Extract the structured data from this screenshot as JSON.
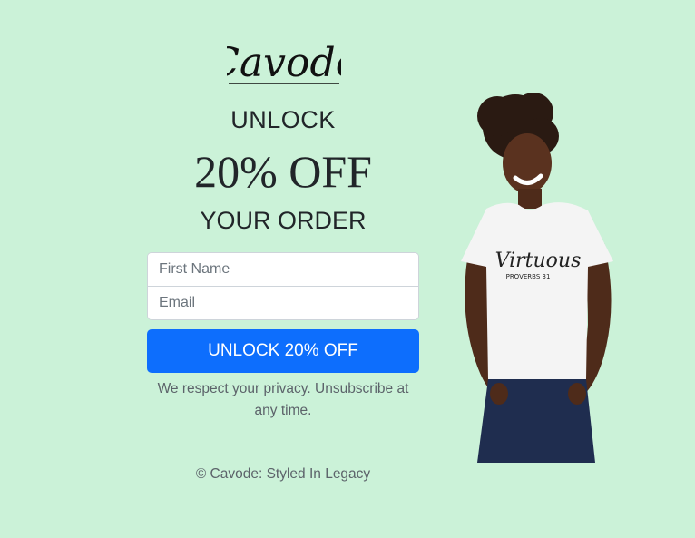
{
  "brand": {
    "logo_text": "Cavode"
  },
  "promo": {
    "line1": "UNLOCK",
    "line2": "20% OFF",
    "line3": "YOUR ORDER"
  },
  "form": {
    "first_name_placeholder": "First Name",
    "first_name_value": "",
    "email_placeholder": "Email",
    "email_value": "",
    "submit_label": "UNLOCK 20% OFF"
  },
  "privacy_note": "We respect your privacy. Unsubscribe at any time.",
  "footer": {
    "copyright": "© Cavode: Styled In Legacy"
  },
  "hero_image": {
    "shirt_text": "Virtuous",
    "shirt_subtext": "PROVERBS 31"
  },
  "colors": {
    "background": "#cbf2d8",
    "accent": "#0d6efd"
  }
}
